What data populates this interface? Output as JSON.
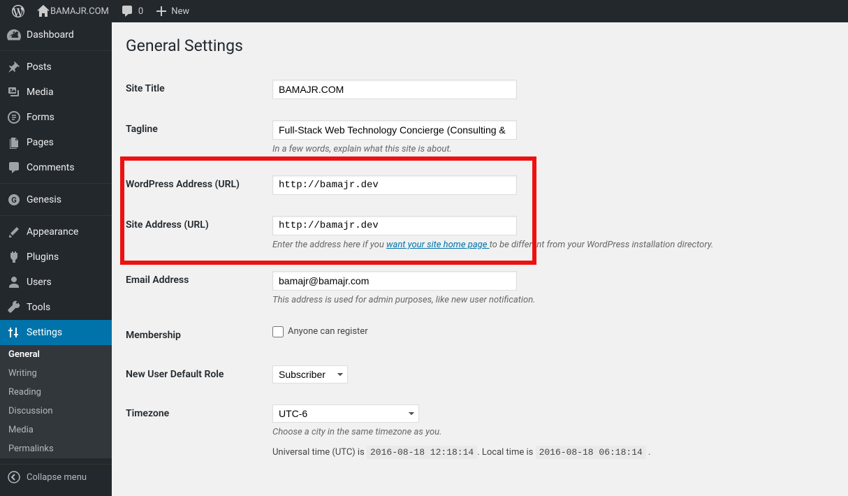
{
  "adminbar": {
    "site_name": "BAMAJR.COM",
    "comments_count": "0",
    "new_label": "New"
  },
  "sidebar": {
    "items": [
      {
        "label": "Dashboard"
      },
      {
        "label": "Posts"
      },
      {
        "label": "Media"
      },
      {
        "label": "Forms"
      },
      {
        "label": "Pages"
      },
      {
        "label": "Comments"
      },
      {
        "label": "Genesis"
      },
      {
        "label": "Appearance"
      },
      {
        "label": "Plugins"
      },
      {
        "label": "Users"
      },
      {
        "label": "Tools"
      },
      {
        "label": "Settings"
      }
    ],
    "submenu": [
      "General",
      "Writing",
      "Reading",
      "Discussion",
      "Media",
      "Permalinks"
    ],
    "collapse_label": "Collapse menu"
  },
  "page": {
    "title": "General Settings",
    "fields": {
      "site_title": {
        "label": "Site Title",
        "value": "BAMAJR.COM"
      },
      "tagline": {
        "label": "Tagline",
        "value": "Full-Stack Web Technology Concierge (Consulting &",
        "desc": "In a few words, explain what this site is about."
      },
      "wp_url": {
        "label": "WordPress Address (URL)",
        "value": "http://bamajr.dev"
      },
      "site_url": {
        "label": "Site Address (URL)",
        "value": "http://bamajr.dev",
        "desc_pre": "Enter the address here if you ",
        "desc_link": "want your site home page ",
        "desc_post": "to be different from your WordPress installation directory."
      },
      "email": {
        "label": "Email Address",
        "value": "bamajr@bamajr.com",
        "desc": "This address is used for admin purposes, like new user notification."
      },
      "membership": {
        "label": "Membership",
        "checkbox_label": "Anyone can register"
      },
      "default_role": {
        "label": "New User Default Role",
        "value": "Subscriber"
      },
      "timezone": {
        "label": "Timezone",
        "value": "UTC-6",
        "desc": "Choose a city in the same timezone as you.",
        "utc_pre": "Universal time (UTC) is ",
        "utc_time": "2016-08-18 12:18:14",
        "local_pre": ". Local time is ",
        "local_time": "2016-08-18 06:18:14",
        "tail": " ."
      }
    }
  }
}
